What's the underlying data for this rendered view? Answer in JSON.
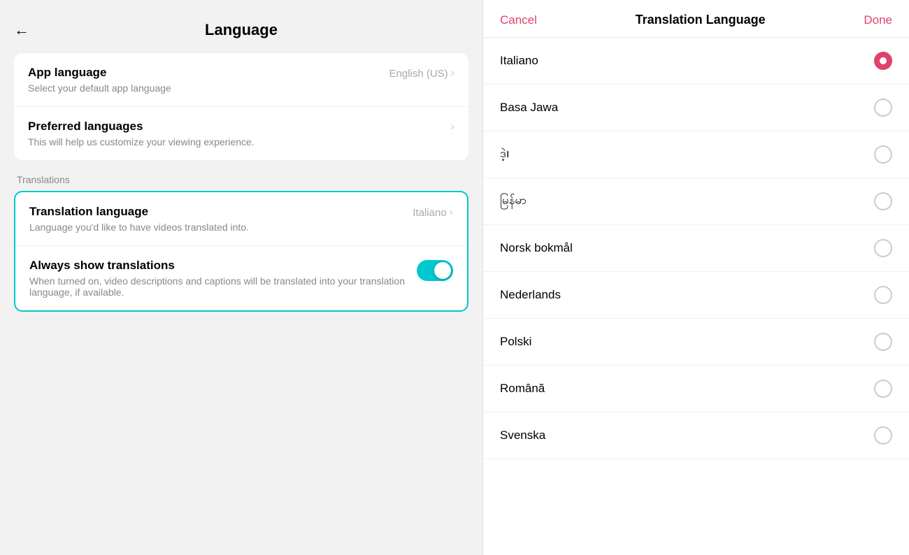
{
  "left": {
    "back_label": "←",
    "title": "Language",
    "app_language_section": {
      "title": "App language",
      "subtitle": "Select your default app language",
      "value": "English (US)"
    },
    "preferred_languages_section": {
      "title": "Preferred languages",
      "subtitle": "This will help us customize your viewing experience."
    },
    "translations_section_label": "Translations",
    "translation_language_row": {
      "title": "Translation language",
      "subtitle": "Language you'd like to have videos translated into.",
      "value": "Italiano"
    },
    "always_show_translations_row": {
      "title": "Always show translations",
      "subtitle": "When turned on, video descriptions and captions will be translated into your translation language, if available."
    }
  },
  "right": {
    "cancel_label": "Cancel",
    "title": "Translation Language",
    "done_label": "Done",
    "languages": [
      {
        "name": "Italiano",
        "selected": true
      },
      {
        "name": "Basa Jawa",
        "selected": false
      },
      {
        "name": "ဒဲ့ı",
        "selected": false
      },
      {
        "name": "မြန်မာ",
        "selected": false
      },
      {
        "name": "Norsk bokmål",
        "selected": false
      },
      {
        "name": "Nederlands",
        "selected": false
      },
      {
        "name": "Polski",
        "selected": false
      },
      {
        "name": "Română",
        "selected": false
      },
      {
        "name": "Svenska",
        "selected": false
      }
    ]
  }
}
